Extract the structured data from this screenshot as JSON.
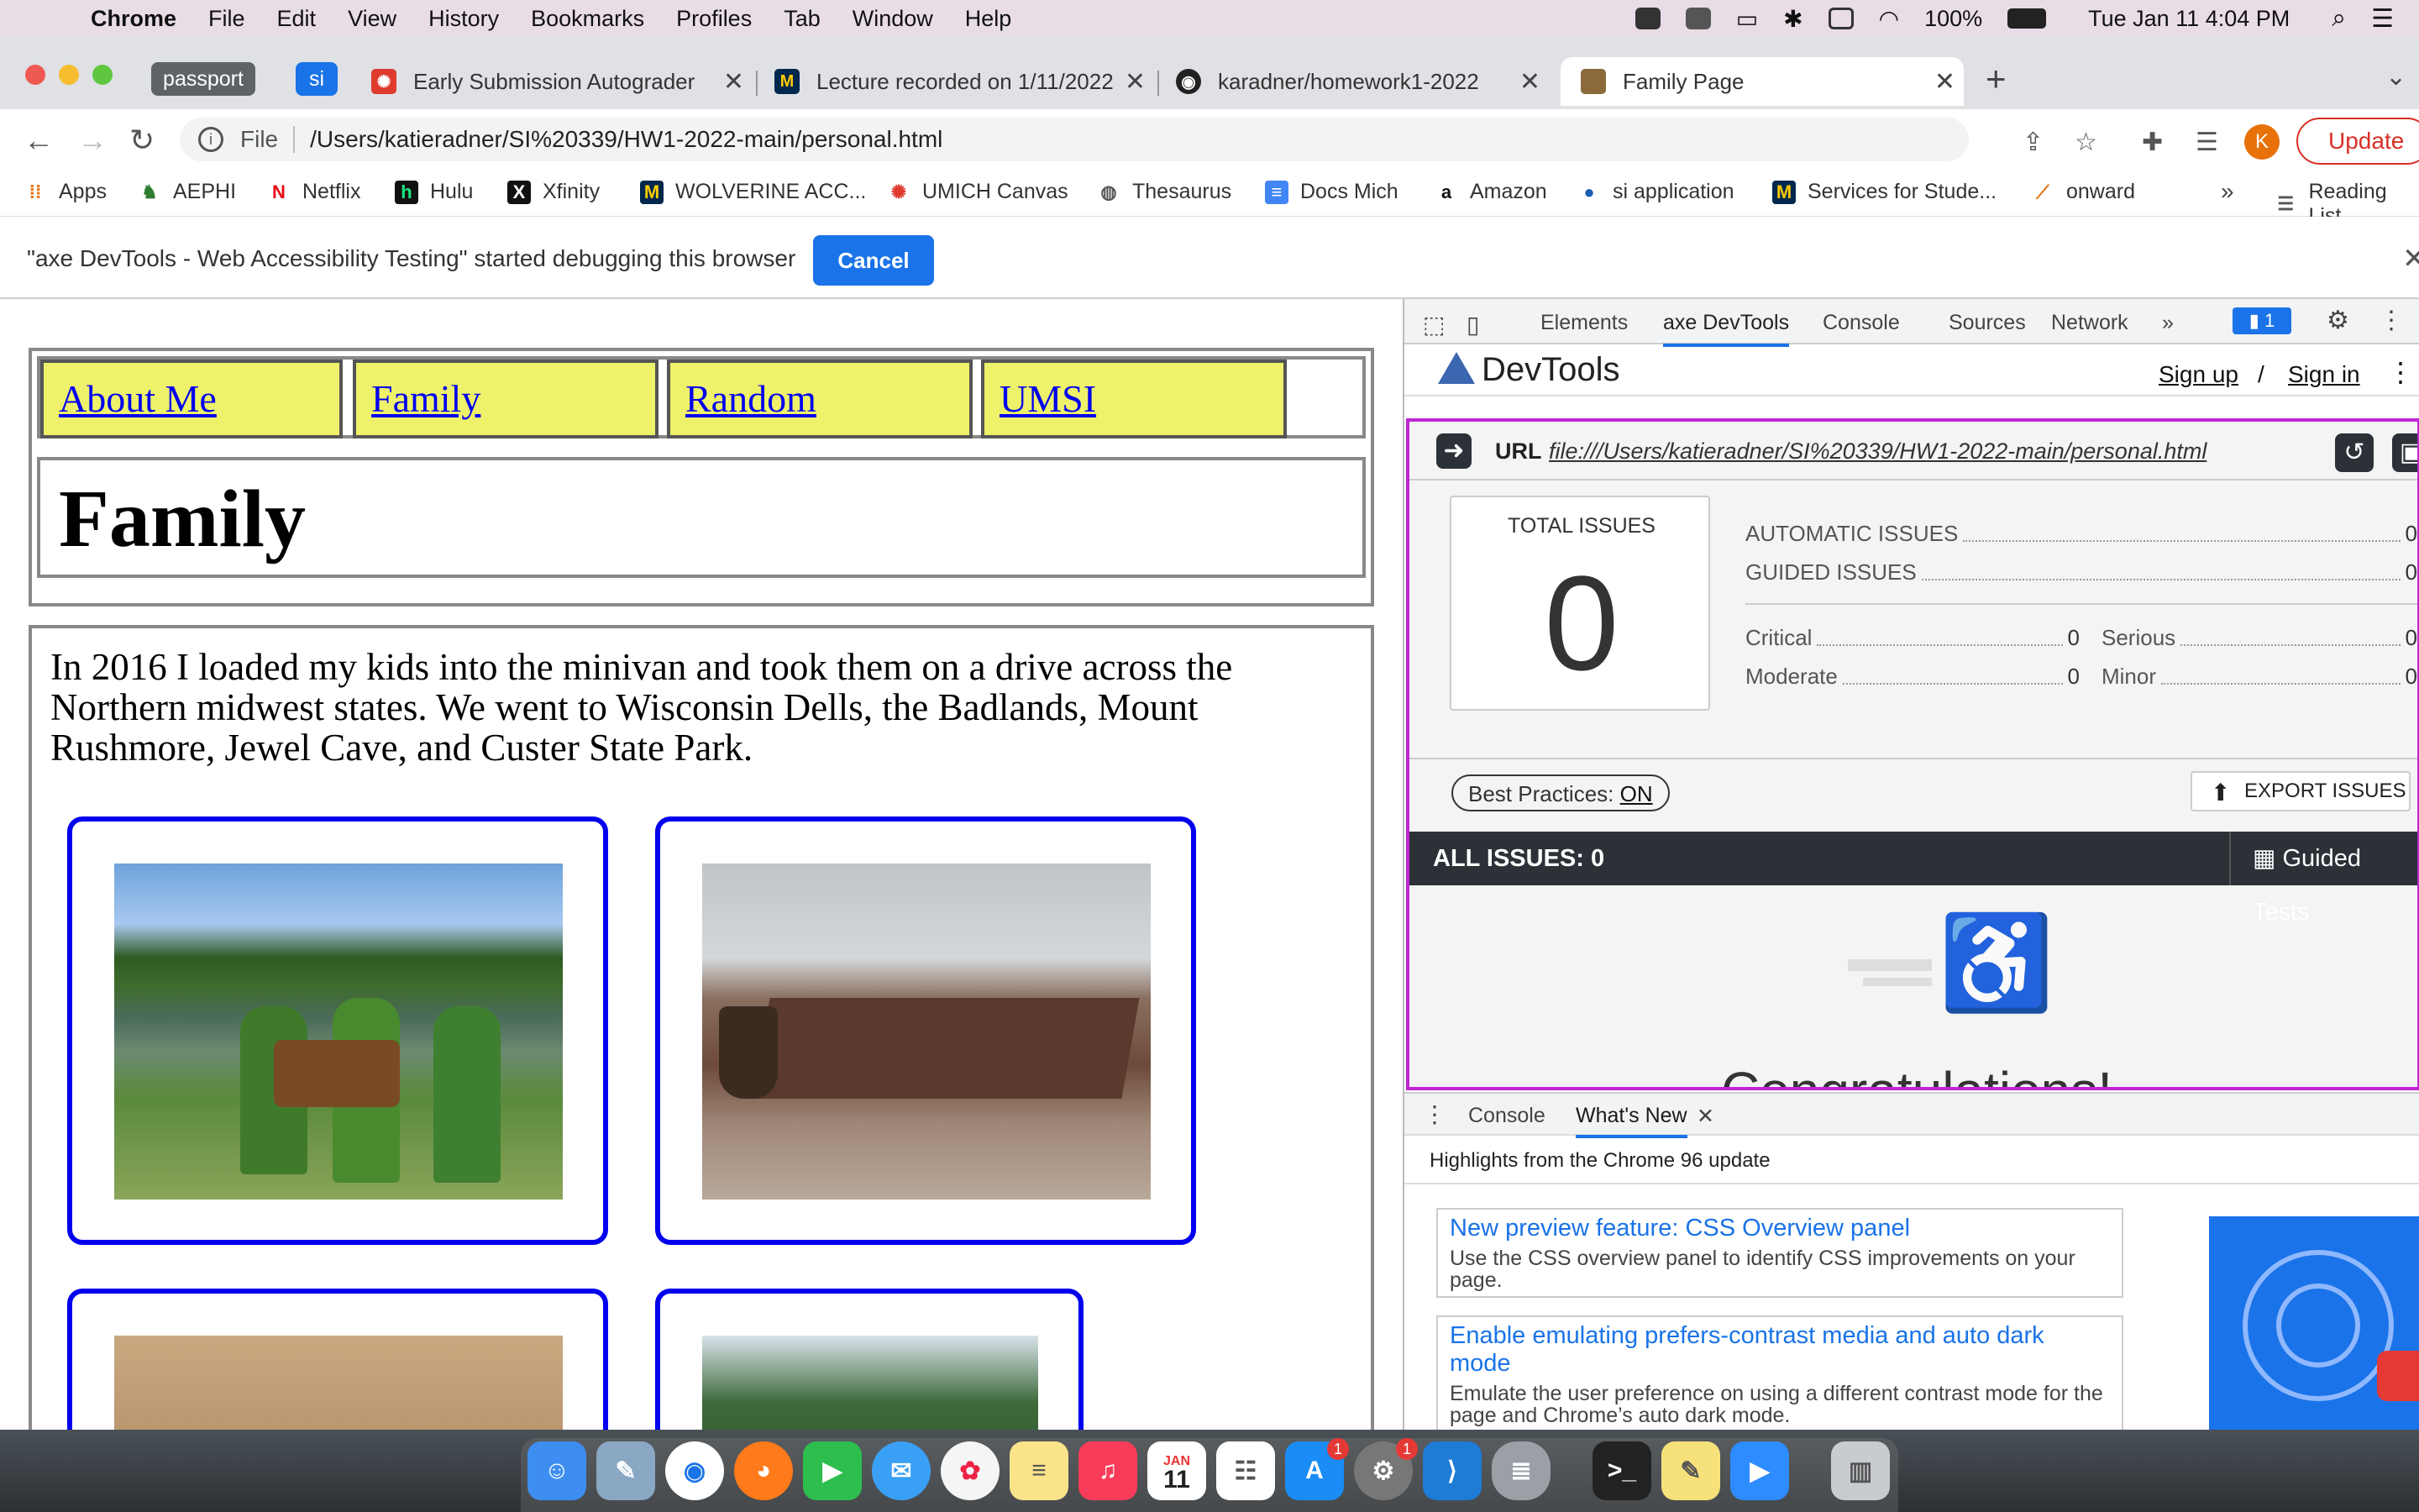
{
  "menubar": {
    "app": "Chrome",
    "items": [
      "File",
      "Edit",
      "View",
      "History",
      "Bookmarks",
      "Profiles",
      "Tab",
      "Window",
      "Help"
    ],
    "battery": "100%",
    "clock": "Tue Jan 11  4:04 PM"
  },
  "tabs": {
    "groups": [
      "passport",
      "si"
    ],
    "items": [
      {
        "title": "Early Submission Autograder"
      },
      {
        "title": "Lecture recorded on 1/11/2022"
      },
      {
        "title": "karadner/homework1-2022"
      },
      {
        "title": "Family Page"
      }
    ],
    "new_tab": "+"
  },
  "omnibox": {
    "scheme": "File",
    "url": "/Users/katieradner/SI%20339/HW1-2022-main/personal.html"
  },
  "profile_initial": "K",
  "update_label": "Update",
  "bookmarks": [
    "Apps",
    "AEPHI",
    "Netflix",
    "Hulu",
    "Xfinity",
    "WOLVERINE ACC...",
    "UMICH Canvas",
    "Thesaurus",
    "Docs Mich",
    "Amazon",
    "si application",
    "Services for Stude...",
    "onward"
  ],
  "bookmarks_more": "»",
  "reading_list": "Reading List",
  "infobar": {
    "message": "\"axe DevTools - Web Accessibility Testing\" started debugging this browser",
    "cancel": "Cancel"
  },
  "page": {
    "nav": [
      "About Me",
      "Family",
      "Random",
      "UMSI"
    ],
    "title": "Family",
    "paragraph": "In 2016 I loaded my kids into the minivan and took them on a drive across the Northern midwest states. We went to Wisconsin Dells, the Badlands, Mount Rushmore, Jewel Cave, and Custer State Park."
  },
  "devtools": {
    "tabs": [
      "Elements",
      "axe DevTools",
      "Console",
      "Sources",
      "Network"
    ],
    "more": "»",
    "issues_badge": "1",
    "axe_title": "DevTools",
    "sign_up": "Sign up",
    "slash": "/",
    "sign_in": "Sign in",
    "url_label": "URL",
    "url_value": "file:///Users/katieradner/SI%20339/HW1-2022-main/personal.html",
    "total_issues_label": "TOTAL ISSUES",
    "total_issues": "0",
    "automatic_label": "AUTOMATIC ISSUES",
    "automatic": "0",
    "guided_label": "GUIDED ISSUES",
    "guided": "0",
    "critical_label": "Critical",
    "critical": "0",
    "serious_label": "Serious",
    "serious": "0",
    "moderate_label": "Moderate",
    "moderate": "0",
    "minor_label": "Minor",
    "minor": "0",
    "best_practices_label": "Best Practices:",
    "best_practices_value": "ON",
    "export_label": "EXPORT ISSUES",
    "all_issues_label": "ALL ISSUES:",
    "all_issues_count": "0",
    "guided_tests": "Guided Tests",
    "congrats": "Congratulations!",
    "drawer_tabs": [
      "Console",
      "What's New"
    ],
    "whats_new_heading": "Highlights from the Chrome 96 update",
    "news": [
      {
        "title": "New preview feature: CSS Overview panel",
        "desc": "Use the CSS overview panel to identify CSS improvements on your page."
      },
      {
        "title": "Enable emulating prefers-contrast media and auto dark mode",
        "desc": "Emulate the user preference on using a different contrast mode for the page and Chrome’s auto dark mode."
      }
    ]
  },
  "dock": {
    "calendar_month": "JAN",
    "calendar_day": "11",
    "badge_appstore": "1",
    "badge_prefs": "1"
  }
}
